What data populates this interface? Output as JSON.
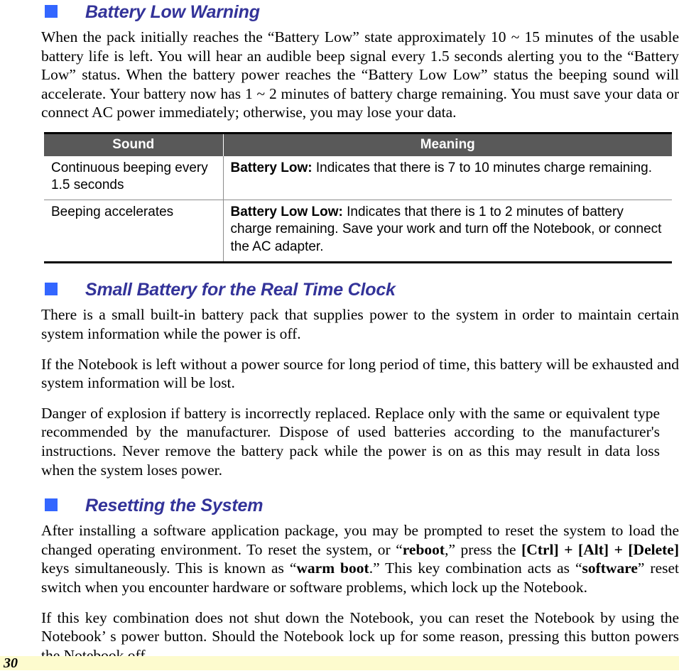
{
  "page": {
    "number": "30",
    "bullet_color": "#3366ff",
    "heading_color": "#333399",
    "footer_bar_color": "#fdfbce",
    "table_header_bg": "#595959"
  },
  "sections": [
    {
      "heading": "Battery Low Warning",
      "paragraphs": [
        "When the pack initially reaches the “Battery Low” state approximately 10 ~ 15 minutes of the usable battery life is left.  You will hear an audible beep signal every 1.5 seconds alerting you to the “Battery Low” status.  When the battery power reaches the “Battery Low Low” status the beeping sound will accelerate.  Your battery now has 1 ~ 2 minutes of battery charge remaining.  You must save your data or connect AC power immediately; otherwise, you may lose your data."
      ]
    },
    {
      "heading": "Small Battery for the Real Time Clock",
      "paragraphs": [
        "There is a small built-in battery pack that supplies power to the system in order to maintain certain system information while the power is off.",
        "If the Notebook is left without a power source for long period of time, this battery will be exhausted and system information will be lost.",
        "Danger of explosion if battery is incorrectly replaced.  Replace only with the same or equivalent type recommended by the manufacturer.  Dispose of used batteries according to the manufacturer's instructions.  Never remove the battery pack while the power is on as this may result in data loss when the system loses power."
      ]
    },
    {
      "heading": "Resetting the System",
      "paragraphs": [
        "If this key combination does not shut down the Notebook, you can reset the Notebook by using the Notebook’ s power button.  Should the Notebook lock up for some reason, pressing this button powers the Notebook off."
      ]
    }
  ],
  "reset_paragraph": {
    "t1": "After installing a software application package, you may be prompted to reset the system to load the changed operating environment.  To reset the system, or “",
    "b1": "reboot",
    "t2": ",” press the ",
    "b2": "[Ctrl] + [Alt] + [Delete]",
    "t3": " keys simultaneously.  This is known as “",
    "b3": "warm boot",
    "t4": ".”  This key combination acts as “",
    "b4": "software",
    "t5": "” reset switch when you encounter hardware or software problems, which lock up the Notebook."
  },
  "table": {
    "columns": [
      "Sound",
      "Meaning"
    ],
    "rows": [
      {
        "sound": "Continuous beeping every 1.5 seconds",
        "meaning_label": "Battery Low:",
        "meaning_text": " Indicates that there is 7 to 10 minutes charge remaining."
      },
      {
        "sound": "Beeping accelerates",
        "meaning_label": "Battery Low Low:",
        "meaning_text": "  Indicates that there is 1 to 2 minutes of battery charge remaining.  Save your work and turn off the Notebook, or connect the AC adapter."
      }
    ]
  }
}
